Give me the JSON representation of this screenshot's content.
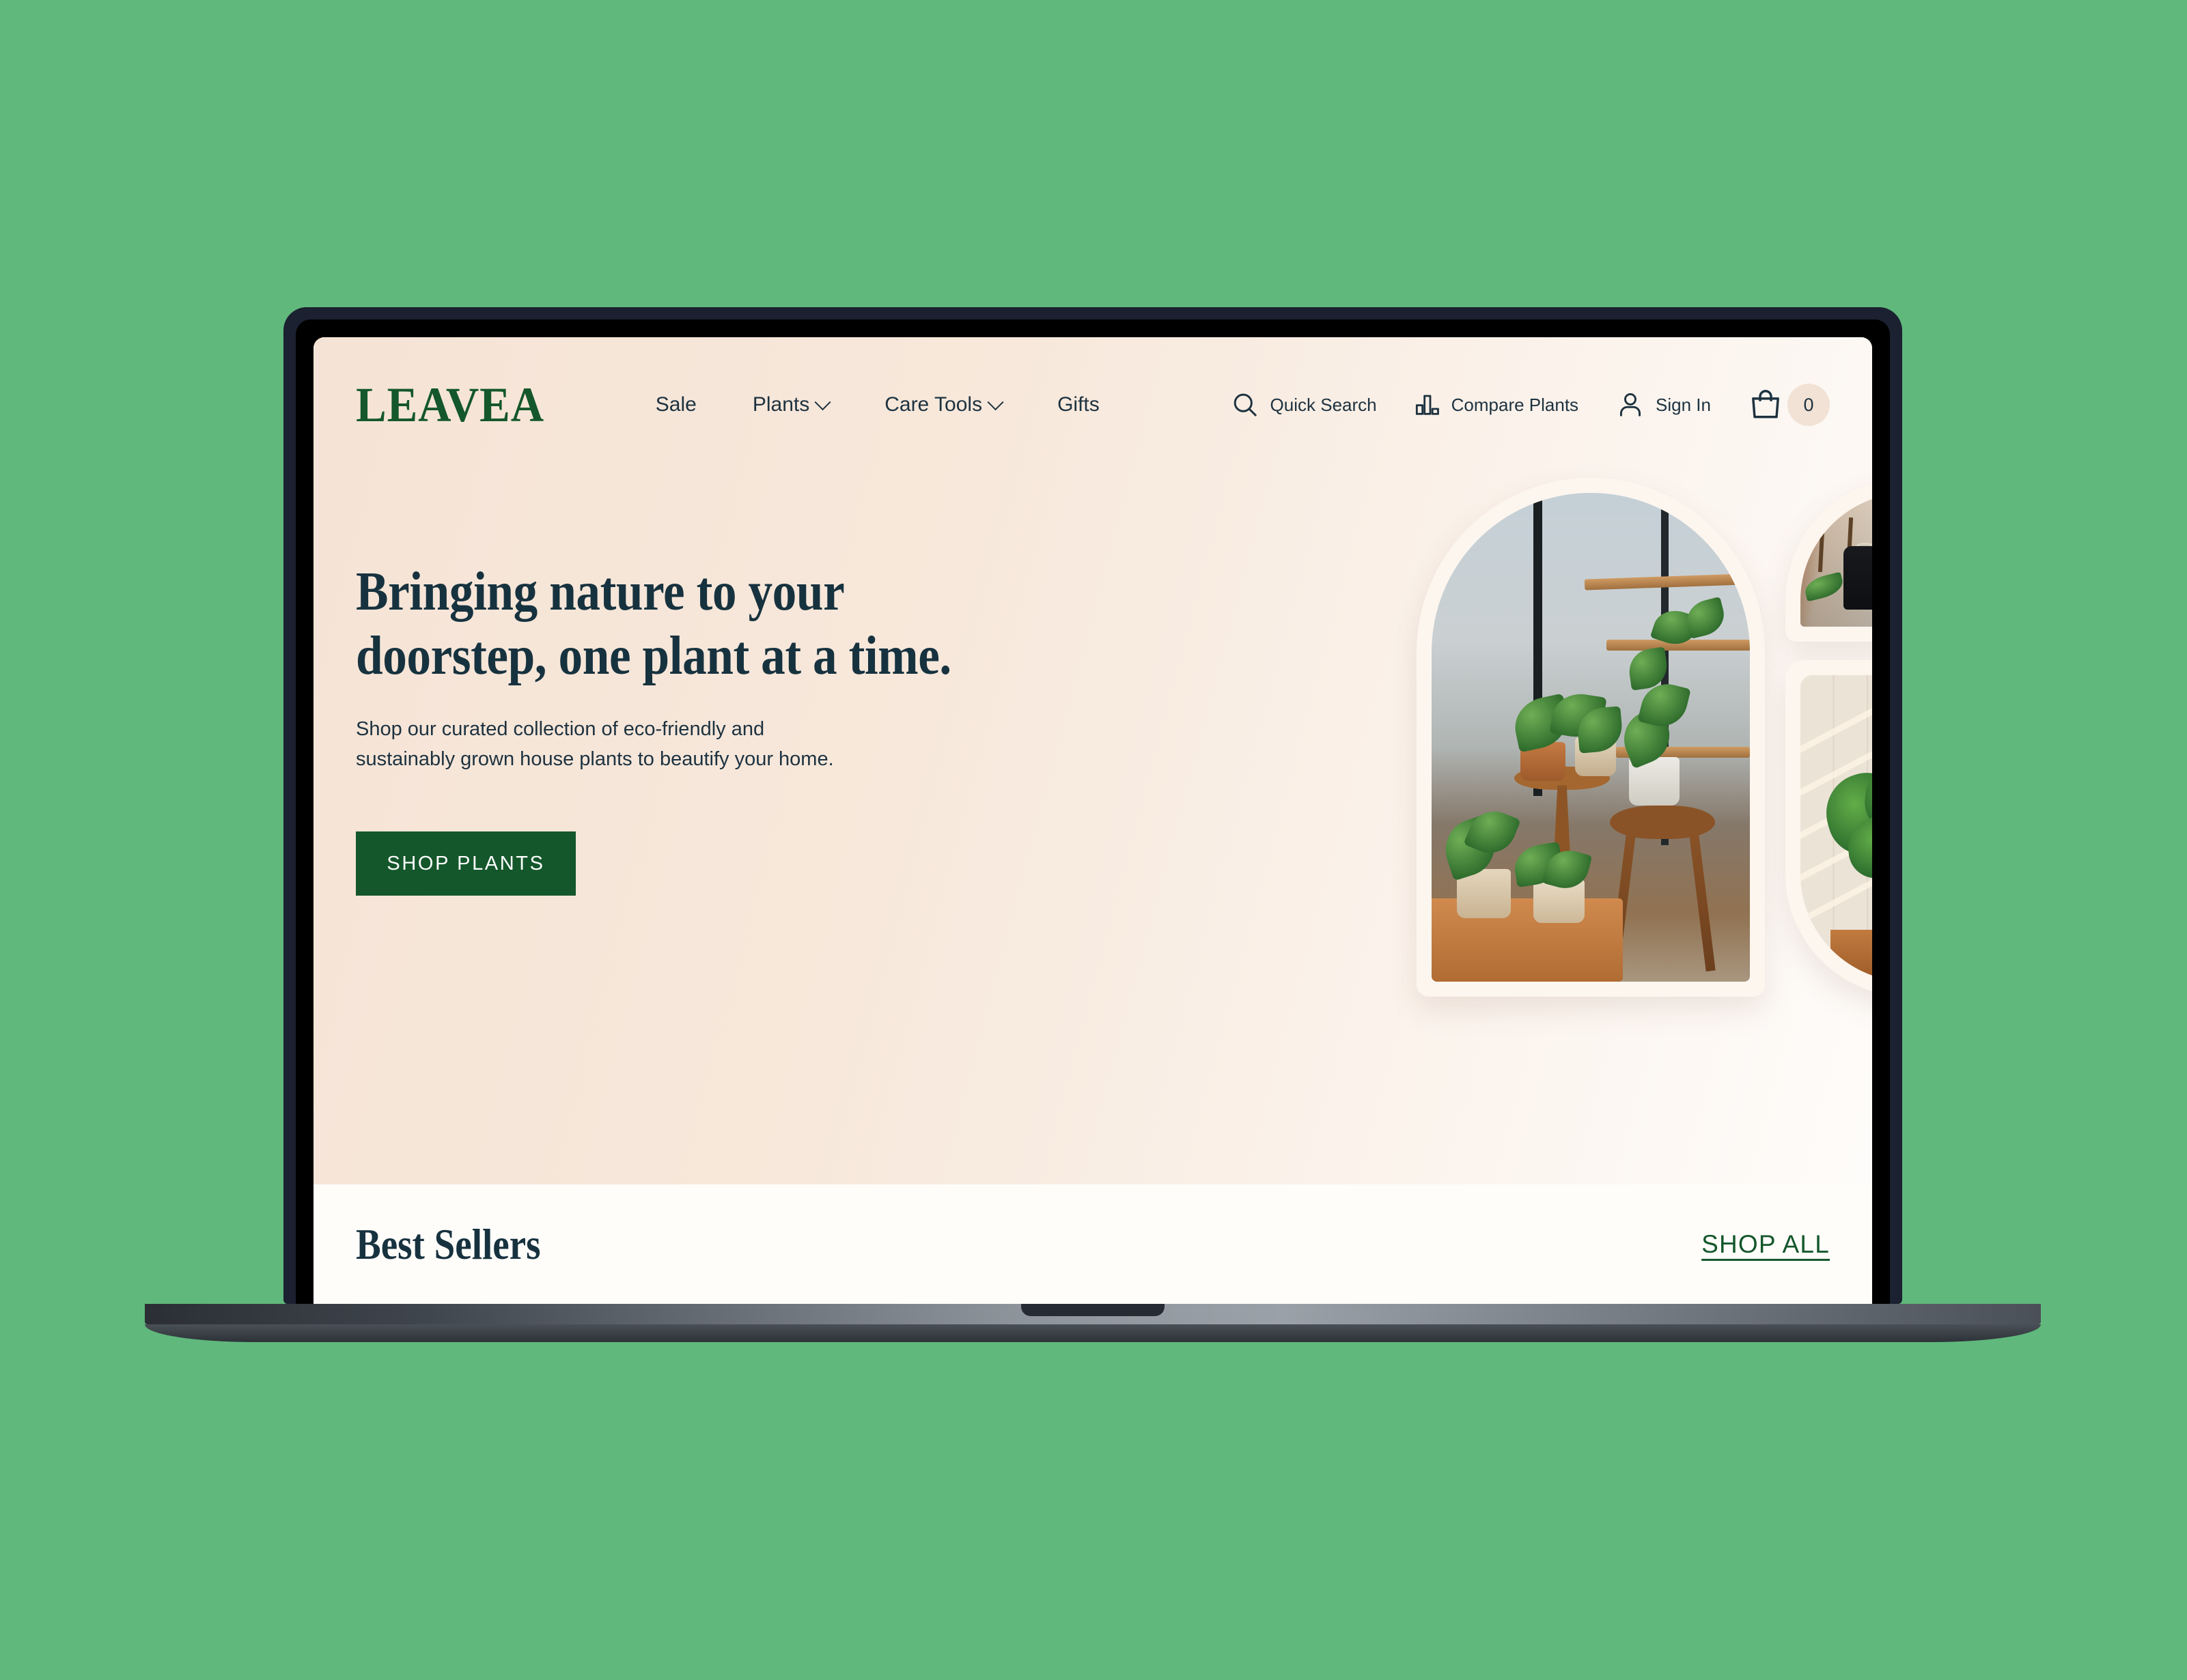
{
  "theme": {
    "page_background": "#60b87c",
    "hero_background_start": "#f5e4d6",
    "hero_background_end": "#fefcfa",
    "brand_green": "#14572b",
    "text_navy": "#1d3240",
    "section_background": "#fffdfa"
  },
  "header": {
    "logo": "LEAVEA",
    "nav": [
      {
        "label": "Sale",
        "has_dropdown": false
      },
      {
        "label": "Plants",
        "has_dropdown": true
      },
      {
        "label": "Care Tools",
        "has_dropdown": true
      },
      {
        "label": "Gifts",
        "has_dropdown": false
      }
    ],
    "utils": {
      "search_label": "Quick Search",
      "search_icon": "search-icon",
      "compare_label": "Compare Plants",
      "compare_icon": "bar-chart-icon",
      "signin_label": "Sign In",
      "signin_icon": "user-icon",
      "cart_icon": "shopping-bag-icon",
      "cart_count": "0"
    }
  },
  "hero": {
    "title": "Bringing nature to your doorstep, one plant at a time.",
    "subtitle": "Shop our curated collection of eco-friendly and sustainably grown house plants to beautify your home.",
    "cta_label": "SHOP PLANTS",
    "images": [
      {
        "name": "plant-shop-interior",
        "shape": "arch",
        "alt": "Plant shop interior with potted plants on wooden stools and benches by a window"
      },
      {
        "name": "shop-wall-shelves",
        "shape": "wide-arch",
        "alt": "Terracotta pots on wall shelves beside a hanging black jacket"
      },
      {
        "name": "monstera-by-blinds",
        "shape": "inverted-arch",
        "alt": "Monstera leaves in an amber glass vase on a sunlit windowsill with wooden blinds"
      }
    ]
  },
  "best_sellers": {
    "title": "Best Sellers",
    "shop_all_label": "SHOP ALL"
  }
}
